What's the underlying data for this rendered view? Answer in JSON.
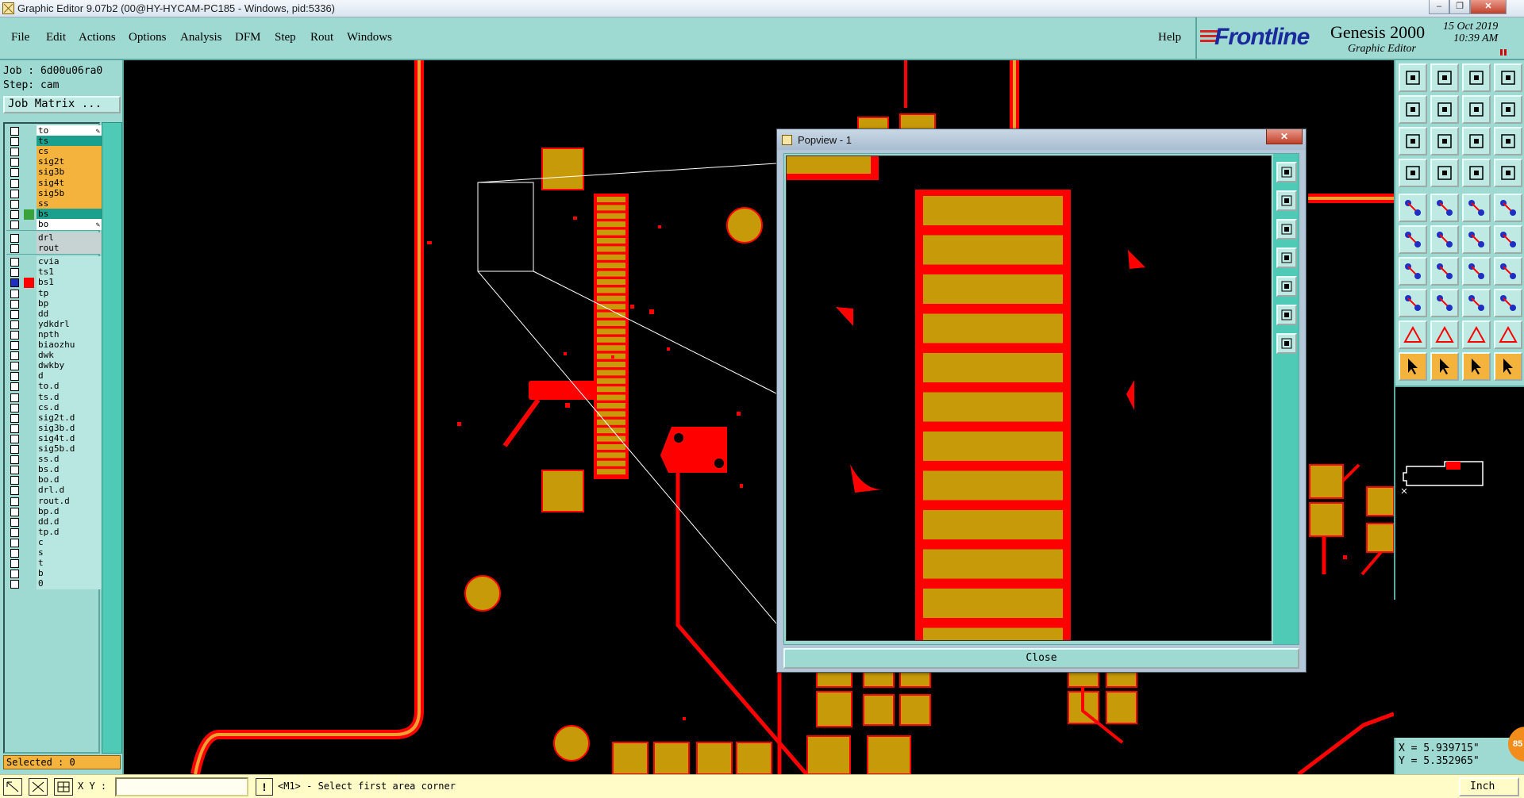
{
  "window": {
    "title": "Graphic Editor 9.07b2 (00@HY-HYCAM-PC185 - Windows, pid:5336)",
    "controls": [
      "minimize",
      "maximize",
      "close"
    ]
  },
  "menubar": {
    "items": [
      "File",
      "Edit",
      "Actions",
      "Options",
      "Analysis",
      "DFM",
      "Step",
      "Rout",
      "Windows"
    ],
    "help": "Help"
  },
  "branding": {
    "logo": "Frontline",
    "product": "Genesis 2000",
    "subtitle": "Graphic Editor",
    "date": "15 Oct 2019",
    "time": "10:39 AM"
  },
  "job": {
    "job_line": "Job : 6d00u06ra0",
    "step_line": "Step: cam",
    "job_matrix_button": "Job Matrix ..."
  },
  "layers": {
    "board": [
      {
        "name": "to",
        "style": "board white",
        "color": "",
        "affected": true
      },
      {
        "name": "ts",
        "style": "teal",
        "color": "",
        "affected": false
      },
      {
        "name": "cs",
        "style": "board",
        "color": "",
        "affected": false
      },
      {
        "name": "sig2t",
        "style": "board",
        "color": "",
        "affected": false
      },
      {
        "name": "sig3b",
        "style": "board",
        "color": "",
        "affected": false
      },
      {
        "name": "sig4t",
        "style": "board",
        "color": "",
        "affected": false
      },
      {
        "name": "sig5b",
        "style": "board",
        "color": "",
        "affected": false
      },
      {
        "name": "ss",
        "style": "board",
        "color": "",
        "affected": false
      },
      {
        "name": "bs",
        "style": "teal",
        "color": "#3aa23a",
        "affected": false
      },
      {
        "name": "bo",
        "style": "board white",
        "color": "",
        "affected": true
      }
    ],
    "drill": [
      {
        "name": "drl",
        "style": "grey"
      },
      {
        "name": "rout",
        "style": "grey"
      }
    ],
    "misc": [
      {
        "name": "cvia",
        "color": "",
        "selected": false
      },
      {
        "name": "ts1",
        "color": "",
        "selected": false
      },
      {
        "name": "bs1",
        "color": "#ff0000",
        "selected": true
      },
      {
        "name": "tp",
        "color": "",
        "selected": false
      },
      {
        "name": "bp",
        "color": "",
        "selected": false
      },
      {
        "name": "dd",
        "color": "",
        "selected": false
      },
      {
        "name": "ydkdrl",
        "color": "",
        "selected": false
      },
      {
        "name": "npth",
        "color": "",
        "selected": false
      },
      {
        "name": "biaozhu",
        "color": "",
        "selected": false
      },
      {
        "name": "dwk",
        "color": "",
        "selected": false
      },
      {
        "name": "dwkby",
        "color": "",
        "selected": false
      },
      {
        "name": "d",
        "color": "",
        "selected": false
      },
      {
        "name": "to.d",
        "color": "",
        "selected": false
      },
      {
        "name": "ts.d",
        "color": "",
        "selected": false
      },
      {
        "name": "cs.d",
        "color": "",
        "selected": false
      },
      {
        "name": "sig2t.d",
        "color": "",
        "selected": false
      },
      {
        "name": "sig3b.d",
        "color": "",
        "selected": false
      },
      {
        "name": "sig4t.d",
        "color": "",
        "selected": false
      },
      {
        "name": "sig5b.d",
        "color": "",
        "selected": false
      },
      {
        "name": "ss.d",
        "color": "",
        "selected": false
      },
      {
        "name": "bs.d",
        "color": "",
        "selected": false
      },
      {
        "name": "bo.d",
        "color": "",
        "selected": false
      },
      {
        "name": "drl.d",
        "color": "",
        "selected": false
      },
      {
        "name": "rout.d",
        "color": "",
        "selected": false
      },
      {
        "name": "bp.d",
        "color": "",
        "selected": false
      },
      {
        "name": "dd.d",
        "color": "",
        "selected": false
      },
      {
        "name": "tp.d",
        "color": "",
        "selected": false
      },
      {
        "name": "c",
        "color": "",
        "selected": false
      },
      {
        "name": "s",
        "color": "",
        "selected": false
      },
      {
        "name": "t",
        "color": "",
        "selected": false
      },
      {
        "name": "b",
        "color": "",
        "selected": false
      },
      {
        "name": "0",
        "color": "",
        "selected": false
      }
    ],
    "selected_count": "Selected : 0"
  },
  "popview": {
    "title": "Popview - 1",
    "close_button": "Close",
    "tools": [
      "zoom-fit-icon",
      "zoom-home-icon",
      "zoom-out-icon",
      "pan-left-icon",
      "pan-right-icon",
      "zoom-area-icon",
      "zoom-center-icon"
    ]
  },
  "statusbar": {
    "xy_label": "X Y :",
    "xy_value": "",
    "message": "<M1> - Select first area corner",
    "units": "Inch"
  },
  "coordinates": {
    "x": "X = 5.939715\"",
    "y": "Y = 5.352965\""
  },
  "badge": "85",
  "colors": {
    "panel": "#9ed9d2",
    "copper": "#c79a0a",
    "highlight": "#ff0000",
    "orange_layer": "#f4b33d",
    "teal_layer": "#1aa08c"
  }
}
